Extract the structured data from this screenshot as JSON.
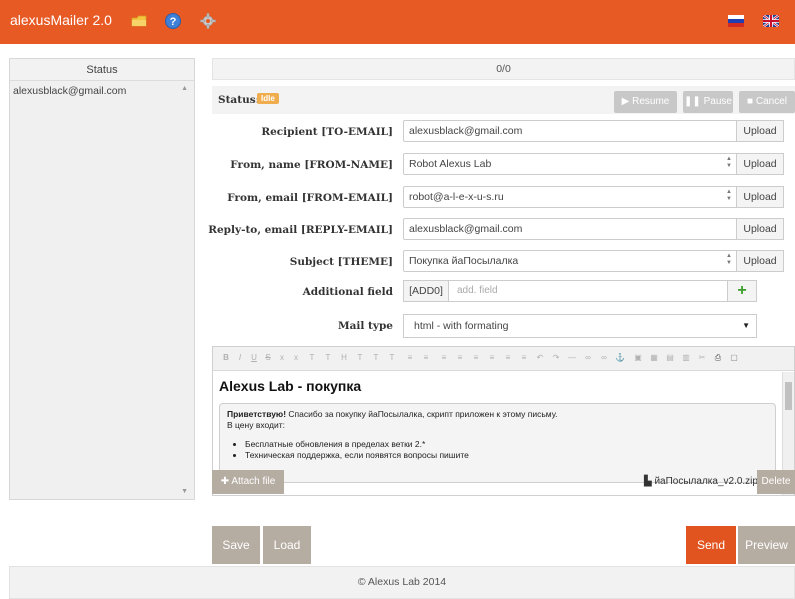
{
  "header": {
    "app_title": "alexusMailer 2.0",
    "icons": [
      "folder-icon",
      "help-icon",
      "gear-icon"
    ],
    "flags": [
      "russia-flag-icon",
      "uk-flag-icon"
    ],
    "accent_color": "#e85a24"
  },
  "sidebar": {
    "header": "Status",
    "items": [
      {
        "email": "alexusblack@gmail.com"
      }
    ]
  },
  "progress": {
    "text": "0/0"
  },
  "status": {
    "label": "Status:",
    "badge": "Idle",
    "buttons": {
      "resume": "Resume",
      "pause": "Pause",
      "cancel": "Cancel"
    }
  },
  "form": {
    "recipient": {
      "label": "Recipient [TO-EMAIL]",
      "value": "alexusblack@gmail.com",
      "upload": "Upload"
    },
    "from_name": {
      "label": "From, name [FROM-NAME]",
      "value": "Robot Alexus Lab",
      "upload": "Upload"
    },
    "from_email": {
      "label": "From, email [FROM-EMAIL]",
      "value": "robot@a-l-e-x-u-s.ru",
      "upload": "Upload"
    },
    "reply_to": {
      "label": "Reply-to, email [REPLY-EMAIL]",
      "value": "alexusblack@gmail.com",
      "upload": "Upload"
    },
    "subject": {
      "label": "Subject [THEME]",
      "value": "Покупка йаПосылалка",
      "upload": "Upload"
    },
    "additional": {
      "label": "Additional field",
      "tag": "[ADD0]",
      "placeholder": "add. field",
      "add_symbol": "+"
    },
    "mail_type": {
      "label": "Mail type",
      "value": "html - with formating"
    }
  },
  "editor": {
    "heading": "Alexus Lab - покупка",
    "greeting": "Приветствую!",
    "intro": " Спасибо за покупку йаПосылалка, скрипт приложен к этому письму.",
    "price_line": "В цену входит:",
    "bullets": [
      "Бесплатные обновления в пределах ветки 2.*",
      "Техническая поддержка, если появятся вопросы пишите"
    ]
  },
  "attachment": {
    "attach_label": "Attach file",
    "filename": "йаПосылалка_v2.0.zip",
    "delete_label": "Delete"
  },
  "actions": {
    "save": "Save",
    "load": "Load",
    "send": "Send",
    "preview": "Preview"
  },
  "footer": {
    "text": "© Alexus Lab 2014"
  }
}
